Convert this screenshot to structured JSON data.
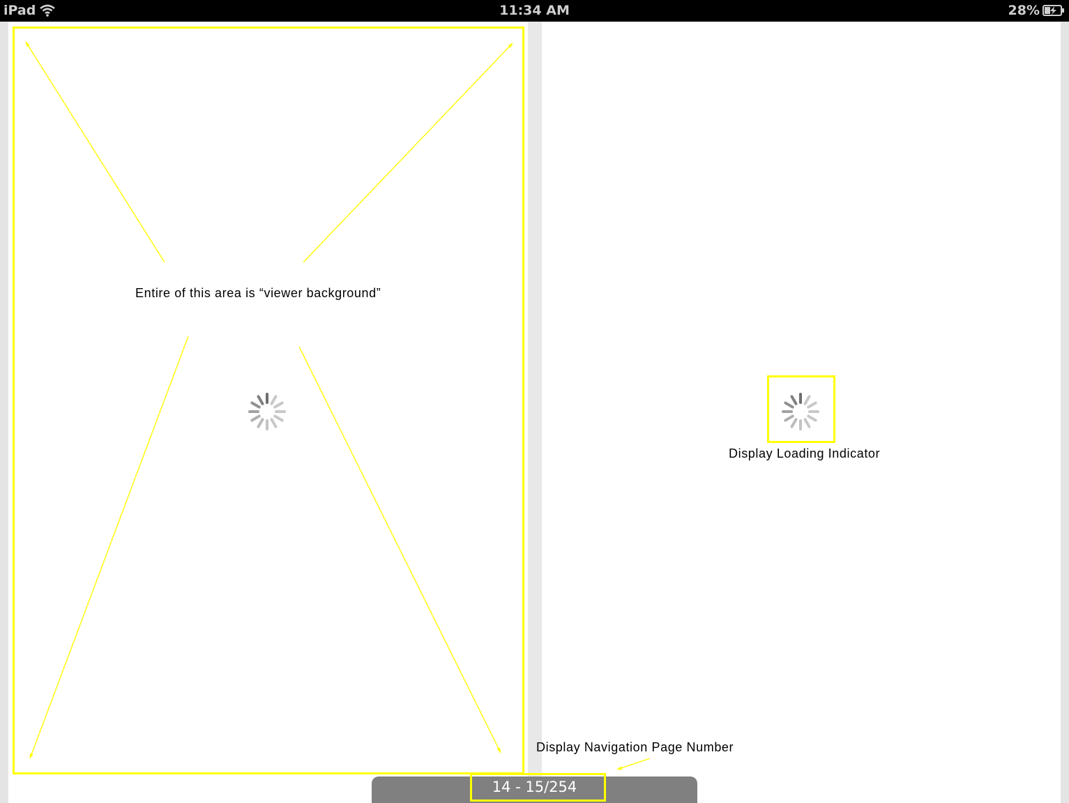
{
  "status_bar": {
    "carrier": "iPad",
    "time": "11:34 AM",
    "battery_percent": "28%",
    "icons": [
      "wifi-icon",
      "battery-charging-icon"
    ]
  },
  "viewer": {
    "left_page_state": "loading",
    "right_page_state": "loading"
  },
  "annotations": {
    "viewer_background": "Entire of this area is “viewer background”",
    "loading_indicator": "Display Loading Indicator",
    "navigation_page_number": "Display Navigation Page Number",
    "highlight_color": "#ffff00"
  },
  "navigation": {
    "page_number": "14 - 15/254",
    "bar_color": "#808080"
  }
}
